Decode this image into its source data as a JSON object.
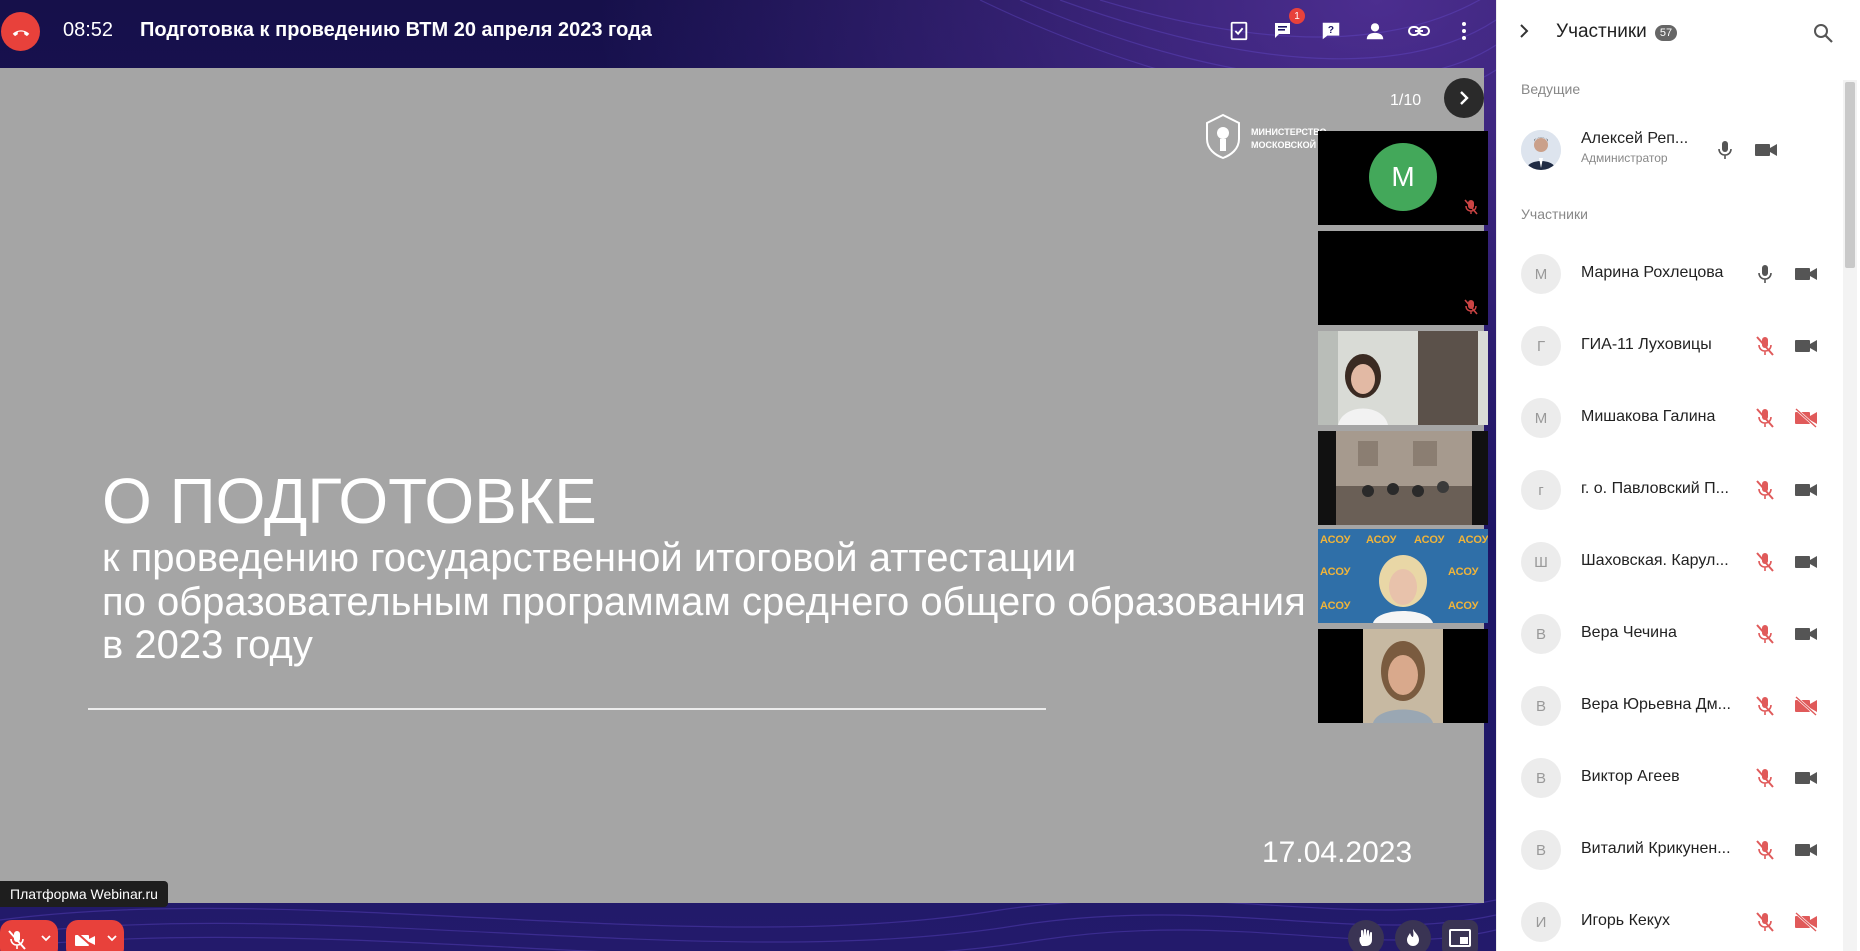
{
  "header": {
    "timer": "08:52",
    "title": "Подготовка к проведению ВТМ 20 апреля 2023 года",
    "chat_badge": "1"
  },
  "slide": {
    "counter": "1/10",
    "heading": "О ПОДГОТОВКЕ",
    "lines": [
      "к проведению государственной итоговой аттестации",
      "по образовательным программам среднего общего образования",
      "в 2023 году"
    ],
    "date": "17.04.2023",
    "logo_lines": [
      "МИНИСТЕРСТВО",
      "МОСКОВСКОЙ"
    ]
  },
  "tiles": [
    {
      "type": "avatar",
      "initial": "М"
    },
    {
      "type": "empty"
    },
    {
      "type": "video"
    },
    {
      "type": "video"
    },
    {
      "type": "video"
    },
    {
      "type": "video"
    }
  ],
  "platform_label": "Платформа Webinar.ru",
  "panel": {
    "title": "Участники",
    "count": "57",
    "host_section": "Ведущие",
    "host": {
      "name": "Алексей Реп...",
      "role": "Администратор"
    },
    "participants_section": "Участники",
    "participants": [
      {
        "initial": "М",
        "name": "Марина Рохлецова",
        "mic": "on",
        "cam": "on"
      },
      {
        "initial": "Г",
        "name": "ГИА-11 Луховицы",
        "mic": "off",
        "cam": "on"
      },
      {
        "initial": "М",
        "name": "Мишакова Галина",
        "mic": "off",
        "cam": "off"
      },
      {
        "initial": "г",
        "name": "г. о. Павловский П...",
        "mic": "off",
        "cam": "on"
      },
      {
        "initial": "Ш",
        "name": "Шаховская. Карул...",
        "mic": "off",
        "cam": "on"
      },
      {
        "initial": "В",
        "name": "Вера Чечина",
        "mic": "off",
        "cam": "on"
      },
      {
        "initial": "В",
        "name": "Вера Юрьевна Дм...",
        "mic": "off",
        "cam": "off"
      },
      {
        "initial": "В",
        "name": "Виктор Агеев",
        "mic": "off",
        "cam": "on"
      },
      {
        "initial": "В",
        "name": "Виталий Крикунен...",
        "mic": "off",
        "cam": "on"
      },
      {
        "initial": "И",
        "name": "Игорь Кекух",
        "mic": "off",
        "cam": "off"
      }
    ]
  },
  "colors": {
    "accent_red": "#e8413b",
    "background_dark": "#1d1565",
    "slide_gray": "#a5a5a5",
    "icon_gray": "#555555"
  }
}
